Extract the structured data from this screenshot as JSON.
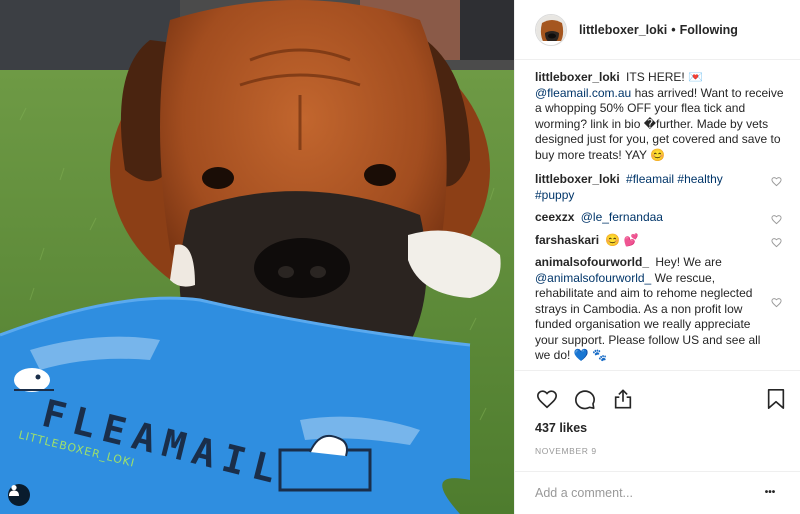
{
  "header": {
    "username": "littleboxer_loki",
    "separator": "•",
    "follow_status": "Following"
  },
  "caption": {
    "username": "littleboxer_loki",
    "text_1": "ITS HERE! 💌",
    "mention": "@fleamail.com.au",
    "text_2": "has arrived! Want to receive a whopping 50% OFF your flea tick and worming? link in bio �further. Made by vets designed just for you, get covered and save to buy more treats! YAY 😊"
  },
  "comments": [
    {
      "username": "littleboxer_loki",
      "text": "#fleamail #healthy #puppy",
      "is_link": true
    },
    {
      "username": "ceexzx",
      "text": "@le_fernandaa",
      "is_link": true
    },
    {
      "username": "farshaskari",
      "text": "😊 💕",
      "is_link": false
    },
    {
      "username": "animalsofourworld_",
      "text_1": "Hey! We are",
      "mention": "@animalsofourworld_",
      "text_2": "We rescue, rehabilitate and aim to rehome neglected strays in Cambodia. As a non profit low funded organisation we really appreciate your support. Please follow US and see all we do! 💙 🐾"
    }
  ],
  "actions": {
    "like_icon": "heart-outline-icon",
    "comment_icon": "comment-bubble-icon",
    "share_icon": "share-icon",
    "save_icon": "bookmark-icon"
  },
  "likes": "437 likes",
  "date": "NOVEMBER 9",
  "add_comment": {
    "placeholder": "Add a comment...",
    "more_label": "•••"
  },
  "photo": {
    "package_brand": "FLEAMAIL",
    "watermark": "LITTLEBOXER_LOKI"
  },
  "colors": {
    "link": "#003569",
    "text": "#262626",
    "muted": "#999999",
    "border": "#efefef",
    "package_blue": "#2f8ee0"
  }
}
